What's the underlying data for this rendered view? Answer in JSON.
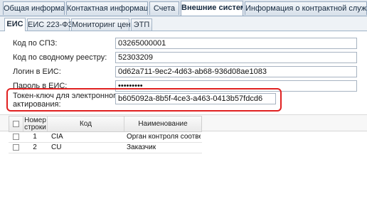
{
  "top_tabs": [
    {
      "label": "Общая информация",
      "active": false
    },
    {
      "label": "Контактная информация",
      "active": false
    },
    {
      "label": "Счета",
      "active": false
    },
    {
      "label": "Внешние системы",
      "active": true
    },
    {
      "label": "Информация о контрактной службе",
      "active": false
    }
  ],
  "sub_tabs": [
    {
      "label": "ЕИС",
      "active": true
    },
    {
      "label": "ЕИС 223-ФЗ",
      "active": false
    },
    {
      "label": "Мониторинг цен",
      "active": false
    },
    {
      "label": "ЭТП",
      "active": false
    }
  ],
  "form": {
    "spz_label": "Код по СПЗ:",
    "spz_value": "03265000001",
    "registry_label": "Код по сводному реестру:",
    "registry_value": "52303209",
    "login_label": "Логин в ЕИС:",
    "login_value": "0d62a711-9ec2-4d63-ab68-936d08ae1083",
    "password_label": "Пароль в ЕИС:",
    "password_value": "•••••••••",
    "token_label_line1": "Токен-ключ для электронного",
    "token_label_line2": "актирования:",
    "token_value": "b605092a-8b5f-4ce3-a463-0413b57fdcd6"
  },
  "highlight_color": "#e02020",
  "toolbar": [
    "add-icon",
    "delete-icon",
    "settings-icon"
  ],
  "grid": {
    "headers": {
      "num_line1": "Номер",
      "num_line2": "строки",
      "code": "Код",
      "name": "Наименование"
    },
    "rows": [
      {
        "num": "1",
        "code": "CIA",
        "name": "Орган контроля соответ..."
      },
      {
        "num": "2",
        "code": "CU",
        "name": "Заказчик"
      }
    ]
  }
}
